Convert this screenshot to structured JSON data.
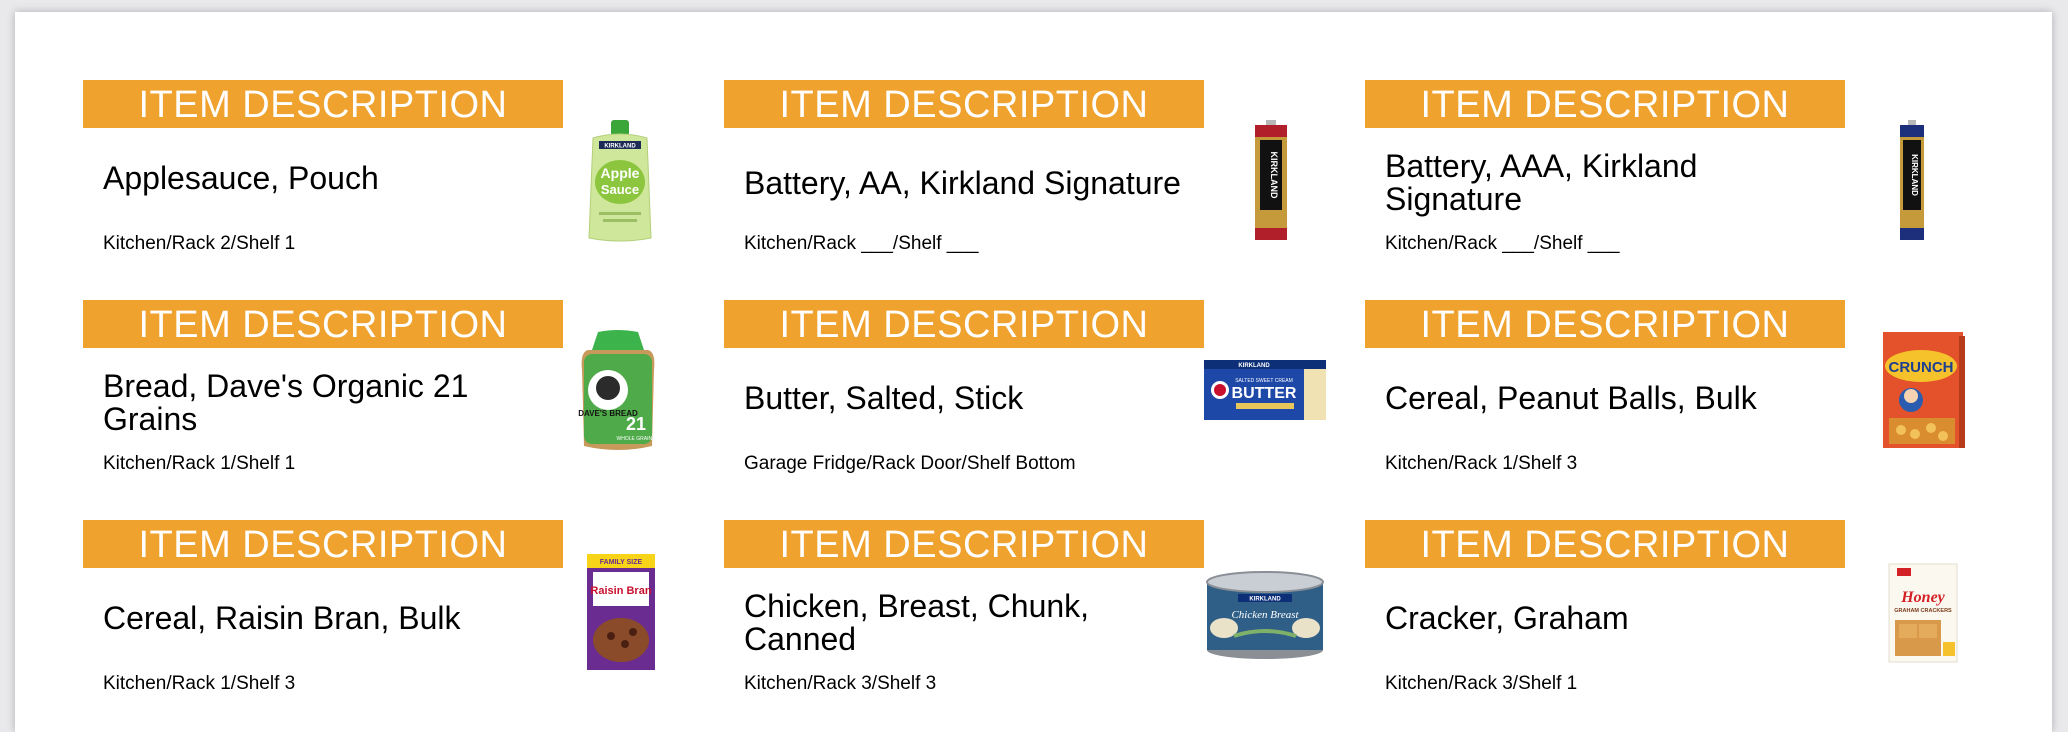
{
  "banner_label": "ITEM DESCRIPTION",
  "colors": {
    "banner": "#f0a22f",
    "banner_text": "#ffffff"
  },
  "items": [
    {
      "name": "Applesauce, Pouch",
      "location": "Kitchen/Rack 2/Shelf 1",
      "image": "applesauce-pouch-image",
      "image_text": {
        "brand": "KIRKLAND",
        "line1": "Apple",
        "line2": "Sauce"
      }
    },
    {
      "name": "Battery, AA, Kirkland Signature",
      "location": "Kitchen/Rack ___/Shelf ___",
      "image": "aa-battery-image",
      "image_text": {
        "brand": "KIRKLAND"
      }
    },
    {
      "name": "Battery, AAA, Kirkland Signature",
      "location": "Kitchen/Rack ___/Shelf ___",
      "image": "aaa-battery-image",
      "image_text": {
        "brand": "KIRKLAND"
      }
    },
    {
      "name": "Bread, Dave's Organic 21 Grains",
      "location": "Kitchen/Rack 1/Shelf 1",
      "image": "bread-bag-image",
      "image_text": {
        "brand": "DAVE'S BREAD",
        "line1": "21",
        "line2": "WHOLE GRAINS"
      }
    },
    {
      "name": "Butter, Salted, Stick",
      "location": "Garage Fridge/Rack Door/Shelf Bottom",
      "image": "butter-box-image",
      "image_text": {
        "brand": "KIRKLAND",
        "line1": "SALTED SWEET CREAM",
        "line2": "BUTTER"
      }
    },
    {
      "name": "Cereal, Peanut Balls, Bulk",
      "location": "Kitchen/Rack 1/Shelf 3",
      "image": "cereal-crunch-box-image",
      "image_text": {
        "line1": "CRUNCH"
      }
    },
    {
      "name": "Cereal, Raisin Bran, Bulk",
      "location": "Kitchen/Rack 1/Shelf 3",
      "image": "raisin-bran-box-image",
      "image_text": {
        "line1": "FAMILY SIZE",
        "line2": "Raisin Bran"
      }
    },
    {
      "name": "Chicken, Breast, Chunk, Canned",
      "location": "Kitchen/Rack 3/Shelf 3",
      "image": "chicken-can-image",
      "image_text": {
        "brand": "KIRKLAND",
        "line1": "Chicken Breast"
      }
    },
    {
      "name": "Cracker, Graham",
      "location": "Kitchen/Rack 3/Shelf 1",
      "image": "graham-cracker-box-image",
      "image_text": {
        "line1": "Honey",
        "line2": "GRAHAM CRACKERS"
      }
    }
  ]
}
